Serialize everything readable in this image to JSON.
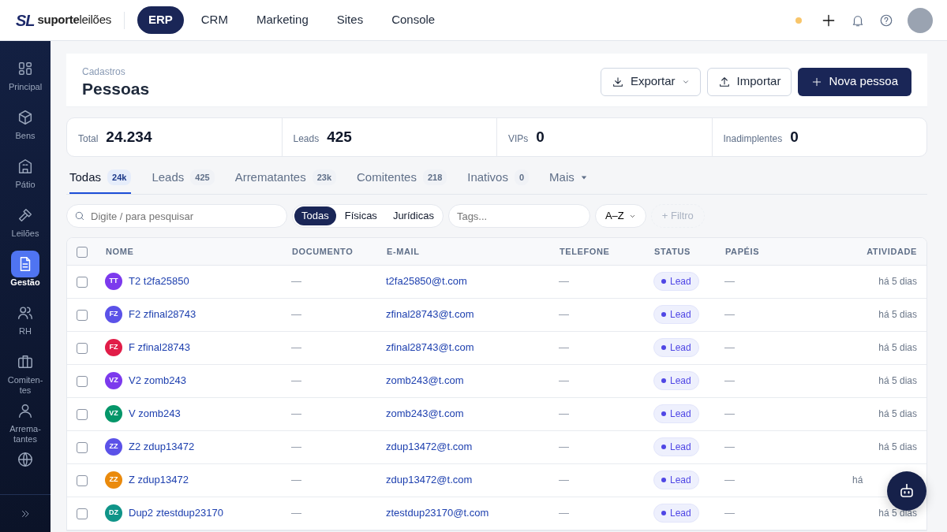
{
  "logo": {
    "mark": "SL",
    "wordmark": "**suporte**leilões"
  },
  "top_nav": [
    {
      "label": "ERP",
      "selected": true
    },
    {
      "label": "CRM",
      "selected": false
    },
    {
      "label": "Marketing",
      "selected": false
    },
    {
      "label": "Sites",
      "selected": false
    },
    {
      "label": "Console",
      "selected": false
    }
  ],
  "sidebar": {
    "items": [
      {
        "label": "Principal",
        "kind": "grid",
        "selected": false
      },
      {
        "label": "Bens",
        "kind": "box",
        "selected": false
      },
      {
        "label": "Pátio",
        "kind": "building",
        "selected": false
      },
      {
        "label": "Leilões",
        "kind": "hammer",
        "selected": false
      },
      {
        "label": "Gestão",
        "kind": "document",
        "selected": true
      },
      {
        "label": "RH",
        "kind": "people",
        "selected": false
      },
      {
        "label": "Comiten-tes",
        "kind": "briefcase",
        "selected": false
      },
      {
        "label": "Arrema-tantes",
        "kind": "person",
        "selected": false
      },
      {
        "kind": "globe",
        "selected": false
      }
    ]
  },
  "header": {
    "breadcrumb": "Cadastros",
    "title": "Pessoas",
    "buttons": [
      {
        "label": "Exportar",
        "kind": "export"
      },
      {
        "label": "Importar",
        "kind": "import"
      },
      {
        "label": "Nova pessoa",
        "kind": "primary"
      }
    ]
  },
  "stats": [
    {
      "label": "Total",
      "value": "24.234"
    },
    {
      "label": "Leads",
      "value": "425"
    },
    {
      "label": "VIPs",
      "value": "0"
    },
    {
      "label": "Inadimplentes",
      "value": "0"
    }
  ],
  "tabs": [
    {
      "label": "Todas",
      "count": "24k",
      "selected": true
    },
    {
      "label": "Leads",
      "count": "425",
      "selected": false
    },
    {
      "label": "Arrematantes",
      "count": "23k",
      "selected": false
    },
    {
      "label": "Comitentes",
      "count": "218",
      "selected": false
    },
    {
      "label": "Inativos",
      "count": "0",
      "selected": false
    },
    {
      "label": "Mais",
      "selected": false
    }
  ],
  "filters": {
    "search": {
      "placeholder": "Digite / para pesquisar"
    },
    "segments": [
      {
        "label": "Todas",
        "selected": true
      },
      {
        "label": "Físicas",
        "selected": false
      },
      {
        "label": "Jurídicas",
        "selected": false
      }
    ],
    "tags": {
      "placeholder": "Tags..."
    },
    "sort": "A–Z",
    "add_filter": "+ Filtro"
  },
  "table": {
    "select_all_checked": false,
    "columns": [
      "NOME",
      "DOCUMENTO",
      "E-MAIL",
      "TELEFONE",
      "STATUS",
      "PAPÉIS",
      "ATIVIDADE"
    ],
    "rows": [
      {
        "checked": false,
        "initials": "TT",
        "color": "#7c3aed",
        "name": "T2 t2fa25850",
        "document": "—",
        "email": "t2fa25850@t.com",
        "phone": "—",
        "status": "Lead",
        "roles": "—",
        "activity": "há 5 dias"
      },
      {
        "checked": false,
        "initials": "FZ",
        "color": "#5b52e8",
        "name": "F2 zfinal28743",
        "document": "—",
        "email": "zfinal28743@t.com",
        "phone": "—",
        "status": "Lead",
        "roles": "—",
        "activity": "há 5 dias"
      },
      {
        "checked": false,
        "initials": "FZ",
        "color": "#e11d48",
        "name": "F zfinal28743",
        "document": "—",
        "email": "zfinal28743@t.com",
        "phone": "—",
        "status": "Lead",
        "roles": "—",
        "activity": "há 5 dias"
      },
      {
        "checked": false,
        "initials": "VZ",
        "color": "#7c3aed",
        "name": "V2 zomb243",
        "document": "—",
        "email": "zomb243@t.com",
        "phone": "—",
        "status": "Lead",
        "roles": "—",
        "activity": "há 5 dias"
      },
      {
        "checked": false,
        "initials": "VZ",
        "color": "#059669",
        "name": "V zomb243",
        "document": "—",
        "email": "zomb243@t.com",
        "phone": "—",
        "status": "Lead",
        "roles": "—",
        "activity": "há 5 dias"
      },
      {
        "checked": false,
        "initials": "ZZ",
        "color": "#5b52e8",
        "name": "Z2 zdup13472",
        "document": "—",
        "email": "zdup13472@t.com",
        "phone": "—",
        "status": "Lead",
        "roles": "—",
        "activity": "há 5 dias"
      },
      {
        "checked": false,
        "initials": "ZZ",
        "color": "#ea8a0c",
        "name": "Z zdup13472",
        "document": "—",
        "email": "zdup13472@t.com",
        "phone": "—",
        "status": "Lead",
        "roles": "—",
        "activity": "há"
      },
      {
        "checked": false,
        "initials": "DZ",
        "color": "#0f9488",
        "name": "Dup2 ztestdup23170",
        "document": "—",
        "email": "ztestdup23170@t.com",
        "phone": "—",
        "status": "Lead",
        "roles": "—",
        "activity": "há 5 dias"
      }
    ]
  }
}
